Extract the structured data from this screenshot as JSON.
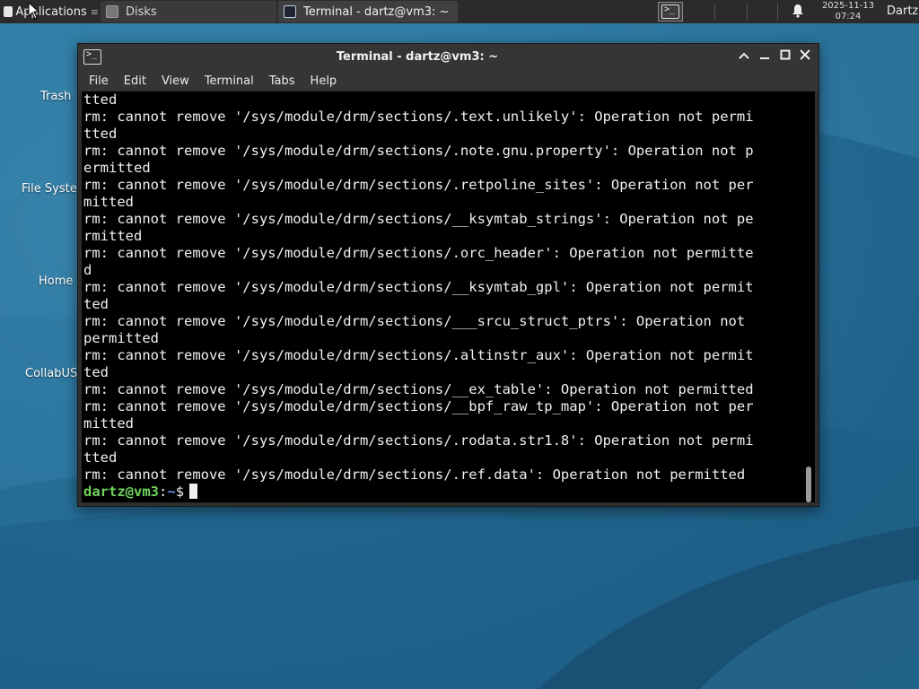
{
  "panel": {
    "applications_label": "Applications",
    "tasks": [
      {
        "label": "Disks",
        "icon": "disk-icon"
      },
      {
        "label": "Terminal - dartz@vm3: ~",
        "icon": "terminal-icon"
      }
    ],
    "clock_date": "2025-11-13",
    "clock_time": "07:24",
    "user_label": "Dartz"
  },
  "desktop": {
    "icons": [
      {
        "label": "Trash"
      },
      {
        "label": "File System"
      },
      {
        "label": "Home"
      },
      {
        "label": "CollabUS"
      }
    ],
    "colors": {
      "background": "#2a6f97",
      "wave_light": "#3b86ad",
      "wave_dark": "#1d5a80"
    }
  },
  "window": {
    "title": "Terminal - dartz@vm3: ~",
    "menu": [
      "File",
      "Edit",
      "View",
      "Terminal",
      "Tabs",
      "Help"
    ],
    "terminal_lines": [
      "tted",
      "rm: cannot remove '/sys/module/drm/sections/.text.unlikely': Operation not permi",
      "tted",
      "rm: cannot remove '/sys/module/drm/sections/.note.gnu.property': Operation not p",
      "ermitted",
      "rm: cannot remove '/sys/module/drm/sections/.retpoline_sites': Operation not per",
      "mitted",
      "rm: cannot remove '/sys/module/drm/sections/__ksymtab_strings': Operation not pe",
      "rmitted",
      "rm: cannot remove '/sys/module/drm/sections/.orc_header': Operation not permitte",
      "d",
      "rm: cannot remove '/sys/module/drm/sections/__ksymtab_gpl': Operation not permit",
      "ted",
      "rm: cannot remove '/sys/module/drm/sections/___srcu_struct_ptrs': Operation not",
      "permitted",
      "rm: cannot remove '/sys/module/drm/sections/.altinstr_aux': Operation not permit",
      "ted",
      "rm: cannot remove '/sys/module/drm/sections/__ex_table': Operation not permitted",
      "rm: cannot remove '/sys/module/drm/sections/__bpf_raw_tp_map': Operation not per",
      "mitted",
      "rm: cannot remove '/sys/module/drm/sections/.rodata.str1.8': Operation not permi",
      "tted",
      "rm: cannot remove '/sys/module/drm/sections/.ref.data': Operation not permitted"
    ],
    "prompt": {
      "user_host": "dartz@vm3",
      "separator": ":",
      "path": "~",
      "symbol": "$"
    }
  }
}
